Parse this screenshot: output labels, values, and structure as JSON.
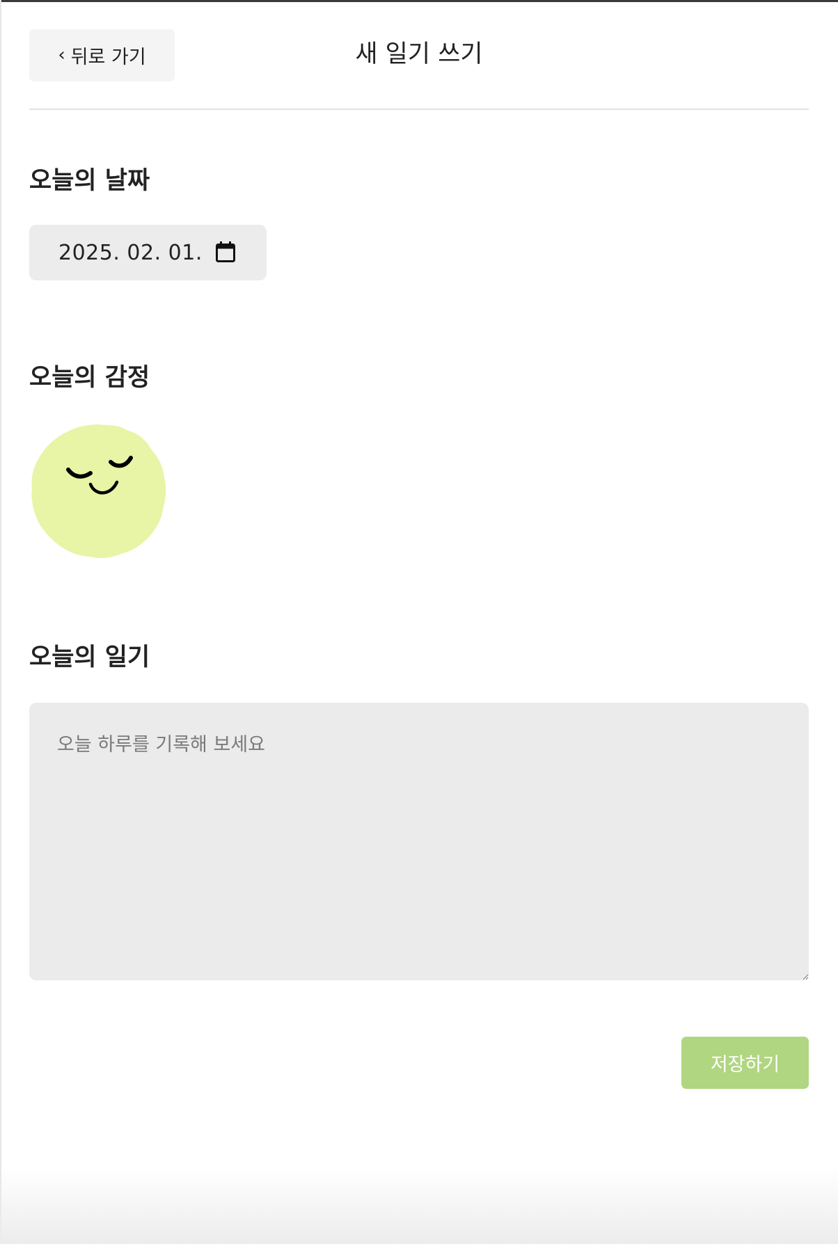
{
  "header": {
    "back_label": "뒤로 가기",
    "back_icon": "chevron-left-icon",
    "title": "새 일기 쓰기"
  },
  "date_section": {
    "label": "오늘의 날짜",
    "value": "2025. 02. 01.",
    "icon": "calendar-icon"
  },
  "emotion_section": {
    "label": "오늘의 감정",
    "selected_emotion_icon": "content-face-icon",
    "face_color": "#e8f4a6"
  },
  "diary_section": {
    "label": "오늘의 일기",
    "placeholder": "오늘 하루를 기록해 보세요",
    "value": ""
  },
  "actions": {
    "save_label": "저장하기",
    "save_color": "#b0d681"
  }
}
